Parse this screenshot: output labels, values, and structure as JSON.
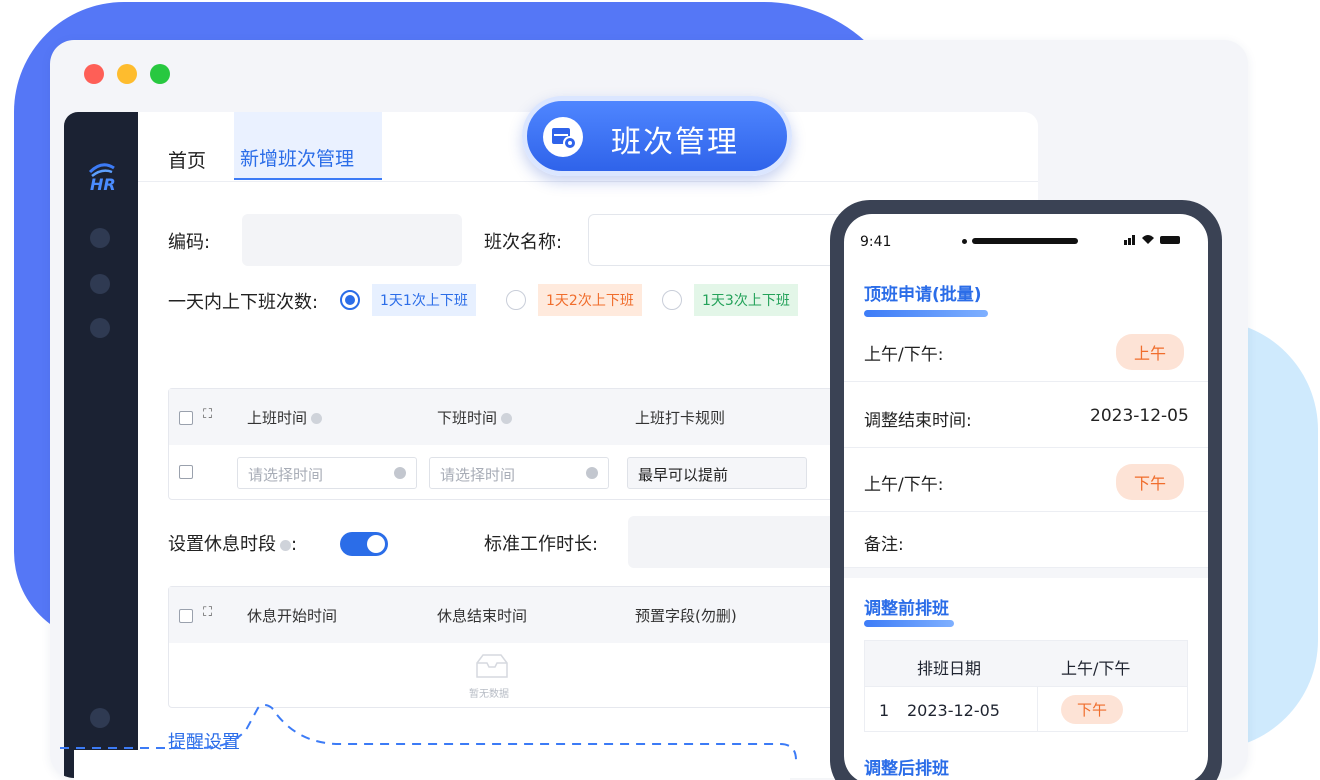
{
  "badge": {
    "title": "班次管理",
    "icon": "calendar-gear-icon"
  },
  "colors": {
    "accent": "#2b6de8",
    "brand_blue": "#5577f6",
    "warning": "#f06d2c"
  },
  "tabs": [
    {
      "label": "首页"
    },
    {
      "label": "新增班次管理"
    }
  ],
  "form": {
    "code_label": "编码:",
    "name_label": "班次名称:",
    "daily_label": "一天内上下班次数:",
    "options": [
      {
        "label": "1天1次上下班",
        "selected": true
      },
      {
        "label": "1天2次上下班",
        "selected": false
      },
      {
        "label": "1天3次上下班",
        "selected": false
      }
    ],
    "rest_label": "设置休息时段",
    "rest_colon": ":",
    "std_label": "标准工作时长:",
    "reminder_label": "提醒设置"
  },
  "table1": {
    "headers": [
      "上班时间",
      "下班时间",
      "上班打卡规则"
    ],
    "row": {
      "start_placeholder": "请选择时间",
      "end_placeholder": "请选择时间",
      "rule": "最早可以提前"
    }
  },
  "table2": {
    "headers": [
      "休息开始时间",
      "休息结束时间",
      "预置字段(勿删)"
    ],
    "empty": "暂无数据"
  },
  "phone": {
    "time": "9:41",
    "page_title": "顶班申请(批量)",
    "rows": [
      {
        "label": "上午/下午:",
        "value": "上午"
      },
      {
        "label": "调整结束时间:",
        "value": "2023-12-05"
      },
      {
        "label": "上午/下午:",
        "value": "下午"
      },
      {
        "label": "备注:",
        "value": ""
      }
    ],
    "before_title": "调整前排班",
    "before_table": {
      "headers": [
        "排班日期",
        "上午/下午"
      ],
      "rows": [
        {
          "index": "1",
          "date": "2023-12-05",
          "period": "下午"
        }
      ]
    },
    "after_title": "调整后排班"
  }
}
